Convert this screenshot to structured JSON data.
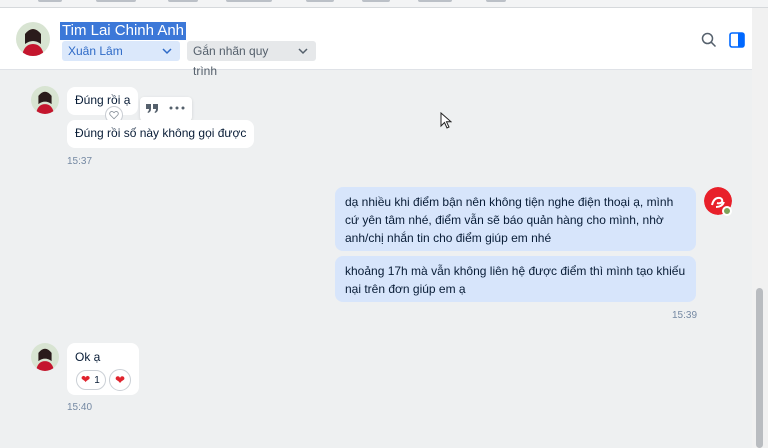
{
  "top_tabs": [
    "Chatbot",
    "Hội đồng",
    "Thống kê",
    "Khách hàng",
    "Quản lý",
    "Hệ thống",
    "Quảng cáo",
    "Khác"
  ],
  "header": {
    "contact_name": "Tim Lai Chinh Anh",
    "owner_tag": "Xuân Lâm",
    "flow_tag": "Gắn nhãn quy trình"
  },
  "messages": {
    "m1_text": "Đúng rồi ạ",
    "m2_text": "Đúng rồi số này không gọi được",
    "m2_time": "15:37",
    "m3_text": "dạ nhiều khi điểm bận nên không tiện nghe điện thoại ạ, mình cứ yên tâm nhé, điểm vẫn sẽ báo quản hàng cho mình, nhờ anh/chị nhắn tin cho điểm giúp em nhé",
    "m4_text": "khoảng 17h mà vẫn không liên hệ được điểm thì mình tạo khiếu nại trên đơn giúp em ạ",
    "m4_time": "15:39",
    "m5_text": "Ok ạ",
    "m5_reaction_count": "1",
    "m5_time": "15:40"
  },
  "colors": {
    "accent": "#0068ff",
    "me_bubble": "#d7e5fb",
    "reaction": "#e0242e"
  },
  "icons": [
    "search-icon",
    "sidebar-panel-icon",
    "quote-icon",
    "more-icon",
    "heart-icon",
    "chevron-down-icon"
  ]
}
